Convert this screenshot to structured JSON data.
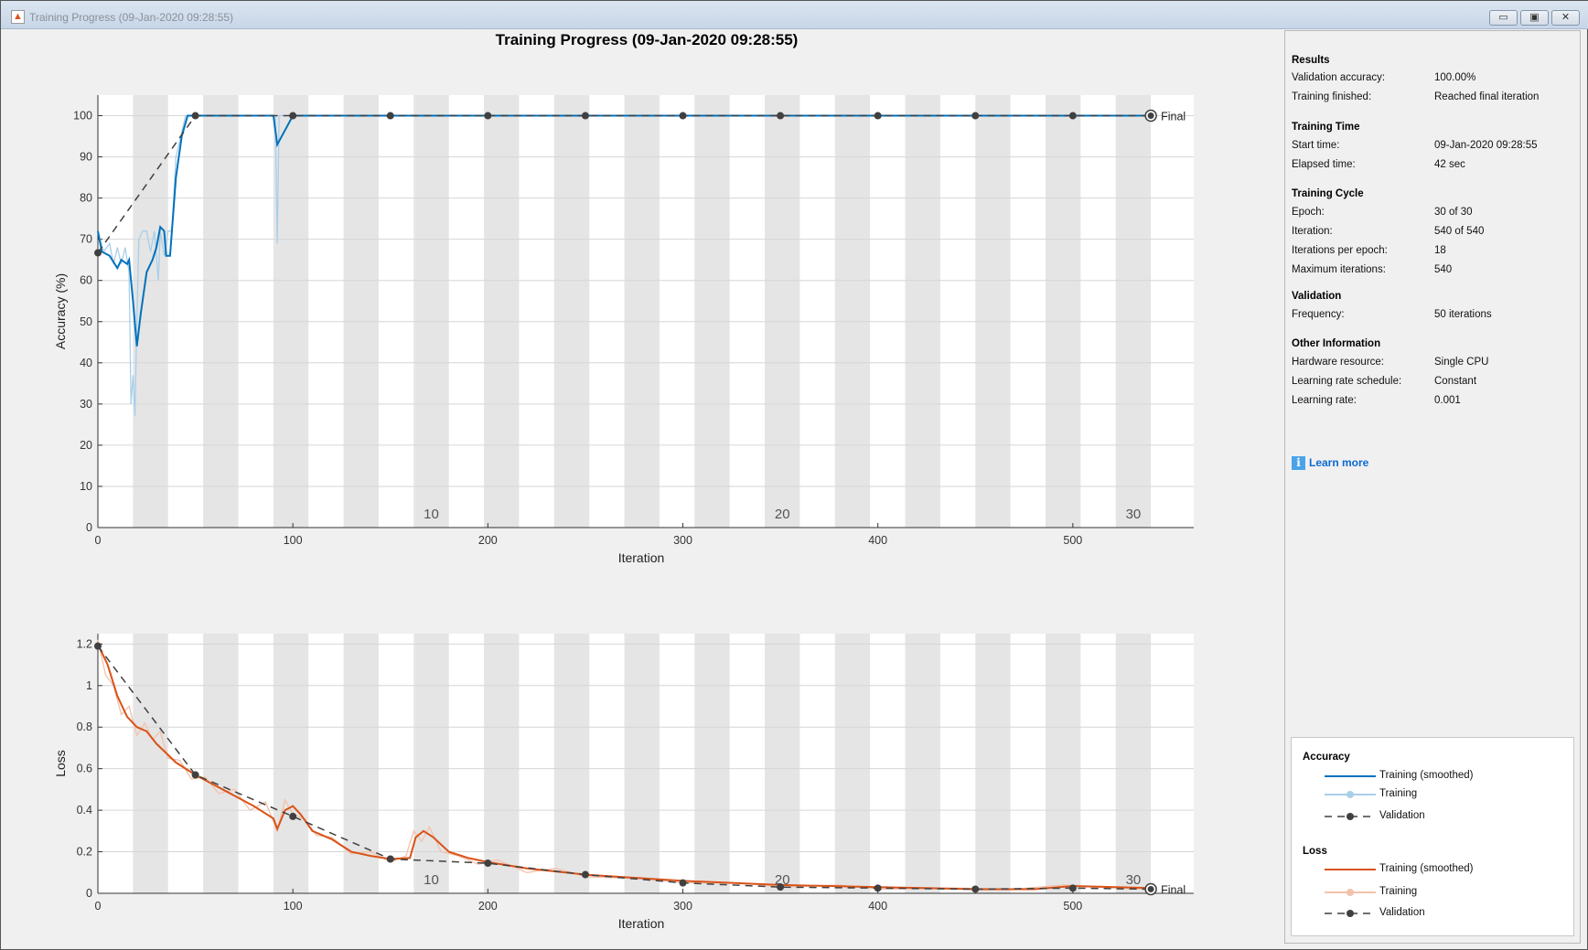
{
  "window": {
    "title": "Training Progress (09-Jan-2020 09:28:55)",
    "buttons": {
      "minimize": "▭",
      "maximize": "▣",
      "close": "✕"
    }
  },
  "panel": {
    "sections": [
      {
        "title": "Results",
        "rows": [
          {
            "label": "Validation accuracy:",
            "value": "100.00%"
          },
          {
            "label": "Training finished:",
            "value": "Reached final iteration"
          }
        ]
      },
      {
        "title": "Training Time",
        "rows": [
          {
            "label": "Start time:",
            "value": "09-Jan-2020 09:28:55"
          },
          {
            "label": "Elapsed time:",
            "value": "42 sec"
          }
        ]
      },
      {
        "title": "Training Cycle",
        "rows": [
          {
            "label": "Epoch:",
            "value": "30 of 30"
          },
          {
            "label": "Iteration:",
            "value": "540 of 540"
          },
          {
            "label": "Iterations per epoch:",
            "value": "18"
          },
          {
            "label": "Maximum iterations:",
            "value": "540"
          }
        ]
      },
      {
        "title": "Validation",
        "rows": [
          {
            "label": "Frequency:",
            "value": "50 iterations"
          }
        ]
      },
      {
        "title": "Other Information",
        "rows": [
          {
            "label": "Hardware resource:",
            "value": "Single CPU"
          },
          {
            "label": "Learning rate schedule:",
            "value": "Constant"
          },
          {
            "label": "Learning rate:",
            "value": "0.001"
          }
        ]
      }
    ],
    "learn_more": "Learn more",
    "learn_icon": "info-icon"
  },
  "legend": {
    "accuracy": {
      "title": "Accuracy",
      "items": [
        "Training (smoothed)",
        "Training",
        "Validation"
      ]
    },
    "loss": {
      "title": "Loss",
      "items": [
        "Training (smoothed)",
        "Training",
        "Validation"
      ]
    }
  },
  "colors": {
    "acc_smooth": "#0072bd",
    "acc_raw": "#a9cfe9",
    "loss_smooth": "#d95319",
    "loss_raw": "#f3c1ab",
    "validation": "#404040",
    "band": "#e5e5e5"
  },
  "chart_data": [
    {
      "type": "line",
      "title": "Training Progress (09-Jan-2020 09:28:55)",
      "xlabel": "Iteration",
      "ylabel": "Accuracy (%)",
      "xlim": [
        0,
        562
      ],
      "ylim": [
        0,
        105
      ],
      "xticks": [
        0,
        100,
        200,
        300,
        400,
        500
      ],
      "yticks": [
        0,
        10,
        20,
        30,
        40,
        50,
        60,
        70,
        80,
        90,
        100
      ],
      "iterations_per_epoch": 18,
      "epochs": 30,
      "epoch_labels": [
        10,
        20,
        30
      ],
      "final_label": "Final",
      "series": [
        {
          "name": "Training (smoothed)",
          "points": [
            [
              0,
              72
            ],
            [
              2,
              67
            ],
            [
              6,
              66
            ],
            [
              10,
              63
            ],
            [
              12,
              65
            ],
            [
              15,
              64
            ],
            [
              16,
              65
            ],
            [
              18,
              55
            ],
            [
              20,
              44
            ],
            [
              22,
              52
            ],
            [
              25,
              62
            ],
            [
              28,
              65
            ],
            [
              30,
              68
            ],
            [
              32,
              73
            ],
            [
              34,
              72
            ],
            [
              35,
              66
            ],
            [
              37,
              66
            ],
            [
              40,
              85
            ],
            [
              43,
              95
            ],
            [
              46,
              100
            ],
            [
              90,
              100
            ],
            [
              92,
              93
            ],
            [
              100,
              100
            ],
            [
              540,
              100
            ]
          ]
        },
        {
          "name": "Training",
          "points": [
            [
              0,
              72
            ],
            [
              3,
              67
            ],
            [
              6,
              69
            ],
            [
              8,
              64
            ],
            [
              10,
              68
            ],
            [
              12,
              64
            ],
            [
              14,
              68
            ],
            [
              16,
              62
            ],
            [
              17,
              30
            ],
            [
              18,
              37
            ],
            [
              19,
              27
            ],
            [
              20,
              50
            ],
            [
              21,
              70
            ],
            [
              23,
              72
            ],
            [
              25,
              72
            ],
            [
              27,
              67
            ],
            [
              29,
              72
            ],
            [
              31,
              60
            ],
            [
              32,
              72
            ],
            [
              34,
              66
            ],
            [
              36,
              72
            ],
            [
              38,
              72
            ],
            [
              40,
              90
            ],
            [
              45,
              100
            ],
            [
              91,
              100
            ],
            [
              92,
              69
            ],
            [
              93,
              100
            ],
            [
              540,
              100
            ]
          ]
        },
        {
          "name": "Validation",
          "points": [
            [
              0,
              66.7
            ],
            [
              50,
              100
            ],
            [
              100,
              100
            ],
            [
              150,
              100
            ],
            [
              200,
              100
            ],
            [
              250,
              100
            ],
            [
              300,
              100
            ],
            [
              350,
              100
            ],
            [
              400,
              100
            ],
            [
              450,
              100
            ],
            [
              500,
              100
            ],
            [
              540,
              100
            ]
          ]
        }
      ]
    },
    {
      "type": "line",
      "xlabel": "Iteration",
      "ylabel": "Loss",
      "xlim": [
        0,
        562
      ],
      "ylim": [
        0,
        1.25
      ],
      "xticks": [
        0,
        100,
        200,
        300,
        400,
        500
      ],
      "yticks": [
        0,
        0.2,
        0.4,
        0.6,
        0.8,
        1,
        1.2
      ],
      "iterations_per_epoch": 18,
      "epochs": 30,
      "epoch_labels": [
        10,
        20,
        30
      ],
      "final_label": "Final",
      "series": [
        {
          "name": "Training (smoothed)",
          "points": [
            [
              0,
              1.2
            ],
            [
              5,
              1.1
            ],
            [
              10,
              0.95
            ],
            [
              15,
              0.85
            ],
            [
              20,
              0.8
            ],
            [
              25,
              0.78
            ],
            [
              30,
              0.72
            ],
            [
              40,
              0.63
            ],
            [
              50,
              0.57
            ],
            [
              60,
              0.52
            ],
            [
              70,
              0.47
            ],
            [
              80,
              0.42
            ],
            [
              90,
              0.36
            ],
            [
              92,
              0.31
            ],
            [
              96,
              0.4
            ],
            [
              100,
              0.42
            ],
            [
              104,
              0.38
            ],
            [
              110,
              0.3
            ],
            [
              120,
              0.26
            ],
            [
              130,
              0.2
            ],
            [
              140,
              0.18
            ],
            [
              150,
              0.165
            ],
            [
              160,
              0.17
            ],
            [
              163,
              0.27
            ],
            [
              167,
              0.3
            ],
            [
              172,
              0.27
            ],
            [
              180,
              0.2
            ],
            [
              190,
              0.17
            ],
            [
              200,
              0.15
            ],
            [
              220,
              0.12
            ],
            [
              250,
              0.09
            ],
            [
              300,
              0.06
            ],
            [
              350,
              0.04
            ],
            [
              400,
              0.03
            ],
            [
              450,
              0.02
            ],
            [
              480,
              0.02
            ],
            [
              500,
              0.035
            ],
            [
              540,
              0.025
            ]
          ]
        },
        {
          "name": "Training",
          "points": [
            [
              0,
              1.22
            ],
            [
              4,
              1.05
            ],
            [
              8,
              1.0
            ],
            [
              12,
              0.86
            ],
            [
              16,
              0.9
            ],
            [
              20,
              0.76
            ],
            [
              24,
              0.82
            ],
            [
              28,
              0.74
            ],
            [
              32,
              0.78
            ],
            [
              36,
              0.65
            ],
            [
              42,
              0.64
            ],
            [
              48,
              0.55
            ],
            [
              55,
              0.56
            ],
            [
              62,
              0.48
            ],
            [
              70,
              0.5
            ],
            [
              78,
              0.4
            ],
            [
              86,
              0.44
            ],
            [
              92,
              0.3
            ],
            [
              96,
              0.45
            ],
            [
              100,
              0.38
            ],
            [
              106,
              0.36
            ],
            [
              112,
              0.28
            ],
            [
              120,
              0.27
            ],
            [
              130,
              0.19
            ],
            [
              140,
              0.2
            ],
            [
              150,
              0.15
            ],
            [
              158,
              0.18
            ],
            [
              162,
              0.3
            ],
            [
              166,
              0.25
            ],
            [
              170,
              0.32
            ],
            [
              176,
              0.2
            ],
            [
              185,
              0.18
            ],
            [
              195,
              0.14
            ],
            [
              205,
              0.16
            ],
            [
              220,
              0.1
            ],
            [
              235,
              0.12
            ],
            [
              250,
              0.08
            ],
            [
              280,
              0.07
            ],
            [
              300,
              0.05
            ],
            [
              330,
              0.05
            ],
            [
              350,
              0.03
            ],
            [
              380,
              0.04
            ],
            [
              400,
              0.02
            ],
            [
              440,
              0.025
            ],
            [
              470,
              0.02
            ],
            [
              495,
              0.04
            ],
            [
              510,
              0.03
            ],
            [
              540,
              0.02
            ]
          ]
        },
        {
          "name": "Validation",
          "points": [
            [
              0,
              1.19
            ],
            [
              50,
              0.57
            ],
            [
              100,
              0.37
            ],
            [
              150,
              0.165
            ],
            [
              200,
              0.145
            ],
            [
              250,
              0.09
            ],
            [
              300,
              0.05
            ],
            [
              350,
              0.03
            ],
            [
              400,
              0.025
            ],
            [
              450,
              0.02
            ],
            [
              500,
              0.025
            ],
            [
              540,
              0.02
            ]
          ]
        }
      ]
    }
  ]
}
